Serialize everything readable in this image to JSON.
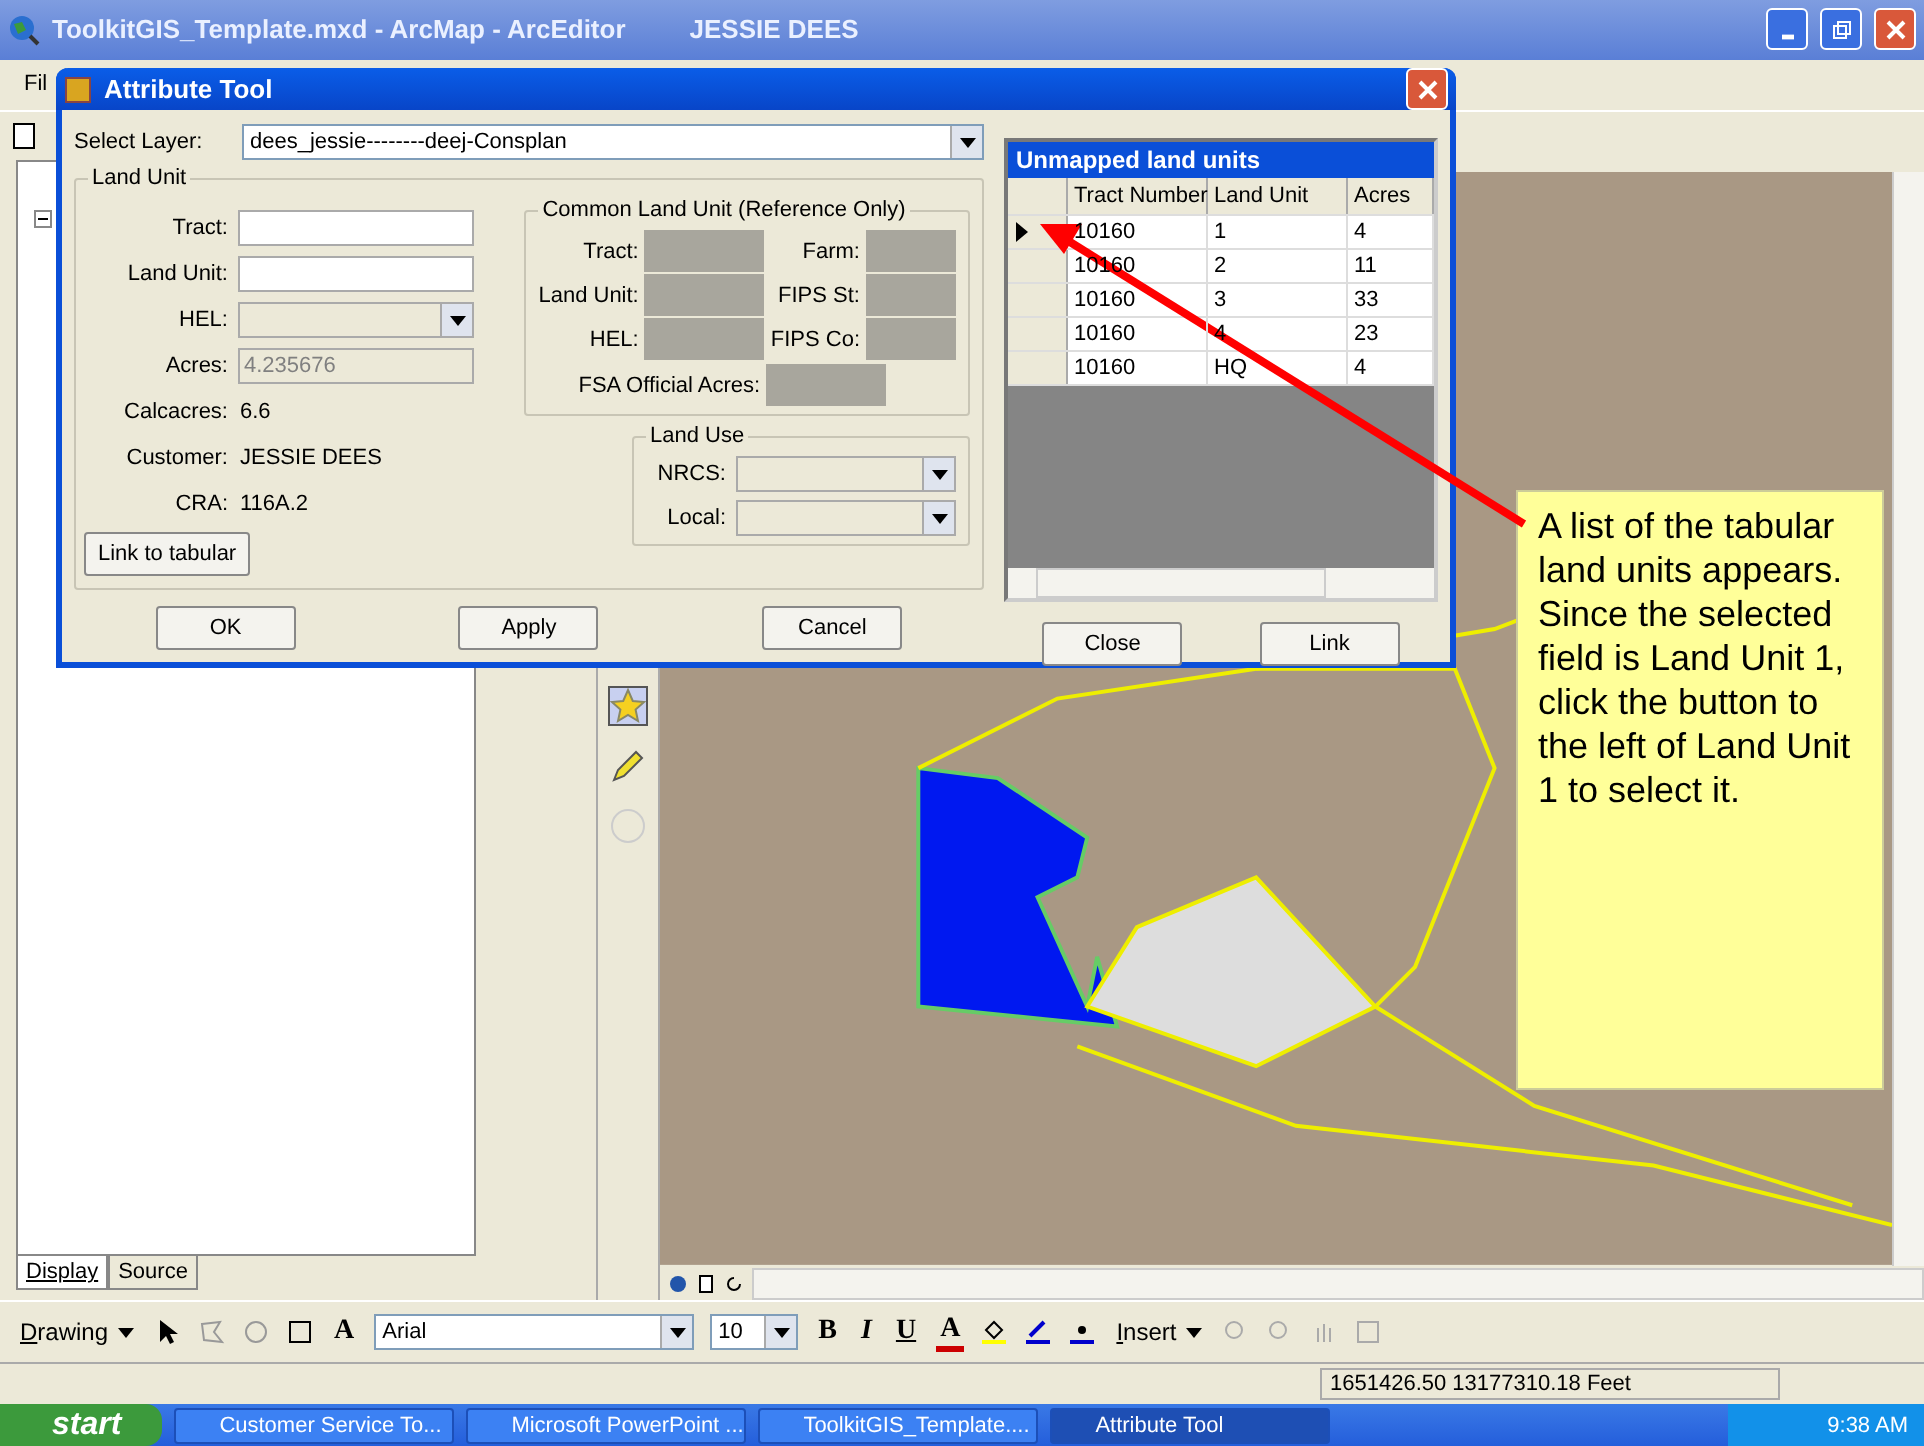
{
  "window": {
    "title": "ToolkitGIS_Template.mxd - ArcMap - ArcEditor",
    "user": "JESSIE DEES"
  },
  "menu_bar": {
    "items": [
      "Fil"
    ]
  },
  "toc_tabs": [
    {
      "label": "Display",
      "selected": true
    },
    {
      "label": "Source",
      "selected": false
    }
  ],
  "dialog": {
    "title": "Attribute Tool",
    "select_layer": {
      "label": "Select Layer:",
      "value": "dees_jessie--------deej-Consplan"
    },
    "land_unit": {
      "title": "Land Unit",
      "fields": [
        {
          "label": "Tract:",
          "kind": "text",
          "disabled": false
        },
        {
          "label": "Land Unit:",
          "kind": "text",
          "disabled": false
        },
        {
          "label": "HEL:",
          "kind": "dropdown",
          "disabled": true
        },
        {
          "label": "Acres:",
          "kind": "text",
          "disabled": true,
          "value": "4.235676"
        }
      ],
      "info": [
        {
          "label": "Calcacres:",
          "value": "6.6"
        },
        {
          "label": "Customer:",
          "value": "JESSIE DEES"
        },
        {
          "label": "CRA:",
          "value": "116A.2"
        }
      ],
      "link_button": "Link to tabular"
    },
    "common_land_unit": {
      "title": "Common Land Unit (Reference Only)",
      "fields": [
        {
          "label": "Tract:"
        },
        {
          "label": "Farm:"
        },
        {
          "label": "Land Unit:"
        },
        {
          "label": "FIPS St:"
        },
        {
          "label": "HEL:"
        },
        {
          "label": "FIPS Co:"
        }
      ],
      "official_acres": {
        "label": "FSA Official Acres:"
      }
    },
    "land_use": {
      "title": "Land Use",
      "fields": [
        {
          "label": "NRCS:"
        },
        {
          "label": "Local:"
        }
      ]
    },
    "buttons": [
      "OK",
      "Apply",
      "Cancel"
    ],
    "unmapped": {
      "title": "Unmapped land units",
      "columns": [
        "Tract Number",
        "Land Unit",
        "Acres"
      ],
      "rows": [
        {
          "cells": [
            "10160",
            "1",
            "4"
          ],
          "selected": true
        },
        {
          "cells": [
            "10160",
            "2",
            "11"
          ],
          "selected": false
        },
        {
          "cells": [
            "10160",
            "3",
            "33"
          ],
          "selected": false
        },
        {
          "cells": [
            "10160",
            "4",
            "23"
          ],
          "selected": false
        },
        {
          "cells": [
            "10160",
            "HQ",
            "4"
          ],
          "selected": false
        }
      ]
    },
    "grid_buttons": [
      "Close",
      "Link"
    ]
  },
  "drawing_toolbar": {
    "drawing_menu": "Drawing",
    "text_tool": "A",
    "font": "Arial",
    "size": "10",
    "bold": "B",
    "italic": "I",
    "underline": "U",
    "font_color": "A",
    "insert_menu": "Insert"
  },
  "status_bar": {
    "coordinates": "1651426.50  13177310.18 Feet"
  },
  "taskbar": {
    "start": "start",
    "tasks": [
      {
        "label": "Customer Service To...",
        "selected": false
      },
      {
        "label": "Microsoft PowerPoint ...",
        "selected": false
      },
      {
        "label": "ToolkitGIS_Template....",
        "selected": false
      },
      {
        "label": "Attribute Tool",
        "selected": true
      }
    ],
    "clock": "9:38 AM"
  },
  "callout": {
    "text": "A list of the tabular land units appears. Since the selected field is Land Unit 1, click the button to the left of Land Unit 1 to select it."
  }
}
